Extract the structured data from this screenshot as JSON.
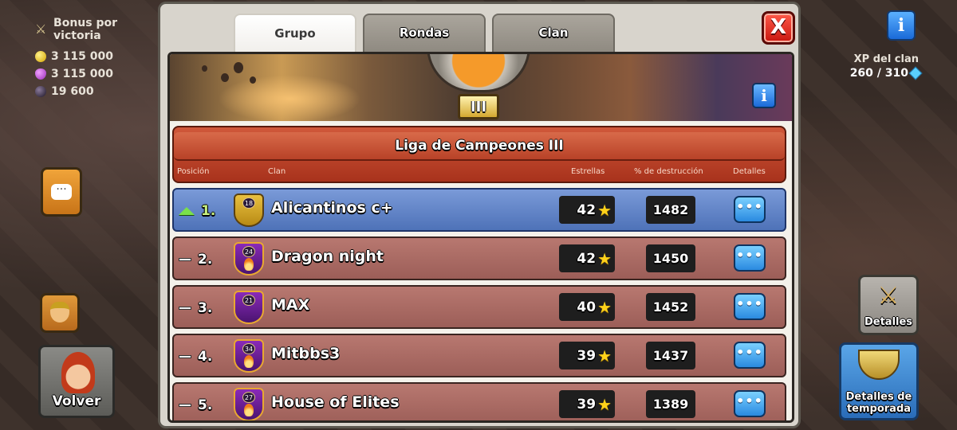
{
  "hud": {
    "bonus_label": "Bonus por victoria",
    "gold": "3 115 000",
    "elixir": "3 115 000",
    "dark_elixir": "19 600",
    "xp_label": "XP del clan",
    "xp_value": "260 / 310"
  },
  "buttons": {
    "back": "Volver",
    "details": "Detalles",
    "season_details": "Detalles de temporada",
    "close": "X",
    "info": "i"
  },
  "tabs": [
    {
      "label": "Grupo",
      "active": true
    },
    {
      "label": "Rondas",
      "active": false
    },
    {
      "label": "Clan",
      "active": false
    }
  ],
  "league": {
    "title": "Liga de Campeones III",
    "tier": "III",
    "columns": {
      "position": "Posición",
      "clan": "Clan",
      "stars": "Estrellas",
      "destruction": "% de destrucción",
      "details": "Detalles"
    }
  },
  "rows": [
    {
      "rank": "1.",
      "trend": "up",
      "level": "18",
      "name": "Alicantinos c+",
      "stars": "42",
      "destruction": "1482",
      "details": "•••"
    },
    {
      "rank": "2.",
      "trend": "none",
      "level": "24",
      "name": "Dragon night",
      "stars": "42",
      "destruction": "1450",
      "details": "•••"
    },
    {
      "rank": "3.",
      "trend": "none",
      "level": "21",
      "name": "MAX",
      "stars": "40",
      "destruction": "1452",
      "details": "•••"
    },
    {
      "rank": "4.",
      "trend": "none",
      "level": "34",
      "name": "Mitbbs3",
      "stars": "39",
      "destruction": "1437",
      "details": "•••"
    },
    {
      "rank": "5.",
      "trend": "none",
      "level": "27",
      "name": "House of Elites",
      "stars": "39",
      "destruction": "1389",
      "details": "•••"
    }
  ],
  "colors": {
    "own_row": "#5a7cc0",
    "other_row": "#a86a62",
    "league_red": "#b84228",
    "close_red": "#e02a1e",
    "details_blue": "#3a9ae8"
  }
}
